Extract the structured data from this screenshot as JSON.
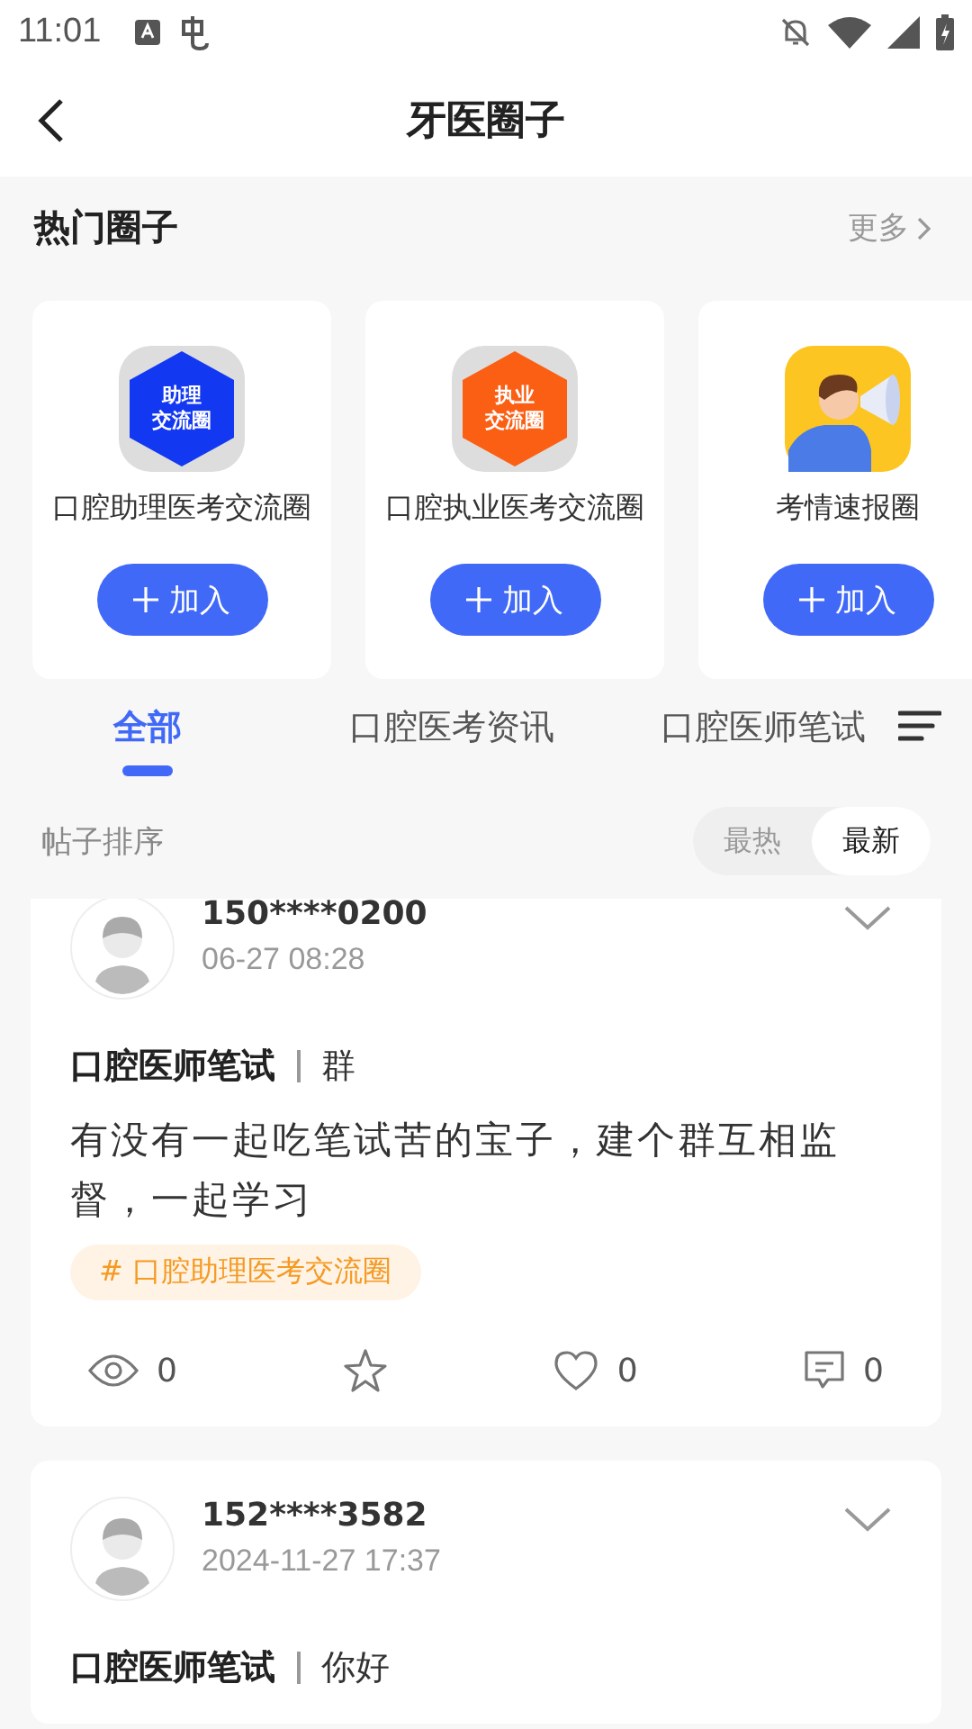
{
  "status_bar": {
    "time": "11:01"
  },
  "header": {
    "title": "牙医圈子"
  },
  "hot_circles": {
    "title": "热门圈子",
    "more": "更多",
    "items": [
      {
        "kind": "badge",
        "color": "#1238f2",
        "logo_text": [
          "助理",
          "交流圈"
        ],
        "name": "口腔助理医考交流圈",
        "join": "加入"
      },
      {
        "kind": "badge",
        "color": "#fb5f14",
        "logo_text": [
          "执业",
          "交流圈"
        ],
        "name": "口腔执业医考交流圈",
        "join": "加入"
      },
      {
        "kind": "illustration",
        "color": "#fcc521",
        "name": "考情速报圈",
        "join": "加入"
      }
    ]
  },
  "tabs": [
    {
      "label": "全部",
      "selected": true
    },
    {
      "label": "口腔医考资讯",
      "selected": false
    },
    {
      "label": "口腔医师笔试",
      "selected": false
    }
  ],
  "sort": {
    "label": "帖子排序",
    "options": [
      {
        "label": "最热",
        "selected": false
      },
      {
        "label": "最新",
        "selected": true
      }
    ]
  },
  "posts": [
    {
      "user": "150****0200",
      "time": "06-27 08:28",
      "category": "口腔医师笔试",
      "title": "群",
      "body": "有没有一起吃笔试苦的宝子，建个群互相监督，一起学习",
      "tag": "# 口腔助理医考交流圈",
      "views": "0",
      "likes": "0",
      "comments": "0"
    },
    {
      "user": "152****3582",
      "time": "2024-11-27 17:37",
      "category": "口腔医师笔试",
      "title": "你好"
    }
  ]
}
